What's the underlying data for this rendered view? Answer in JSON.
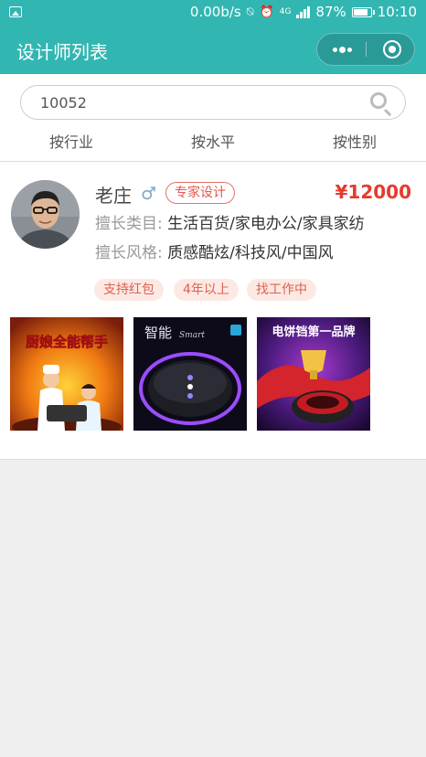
{
  "status_bar": {
    "net_speed": "0.00b/s",
    "net_type": "4G",
    "battery": "87%",
    "time": "10:10"
  },
  "nav": {
    "title": "设计师列表"
  },
  "search": {
    "value": "10052"
  },
  "filters": [
    "按行业",
    "按水平",
    "按性别"
  ],
  "designer": {
    "name": "老庄",
    "gender_symbol": "♂",
    "level_tag": "专家设计",
    "price": "¥12000",
    "category_label": "擅长类目:",
    "category_value": "生活百货/家电办公/家具家纺",
    "style_label": "擅长风格:",
    "style_value": "质感酷炫/科技风/中国风",
    "tags": [
      "支持红包",
      "4年以上",
      "找工作中"
    ],
    "works": [
      {
        "text": "厨娘全能帮手"
      },
      {
        "text": "智能",
        "text2": "Smart"
      },
      {
        "text": "电饼铛第一品牌"
      }
    ]
  },
  "colors": {
    "primary": "#32b6b2",
    "price": "#e53b2c",
    "tag_bg": "#fde9e4",
    "tag_text": "#e0604f"
  }
}
